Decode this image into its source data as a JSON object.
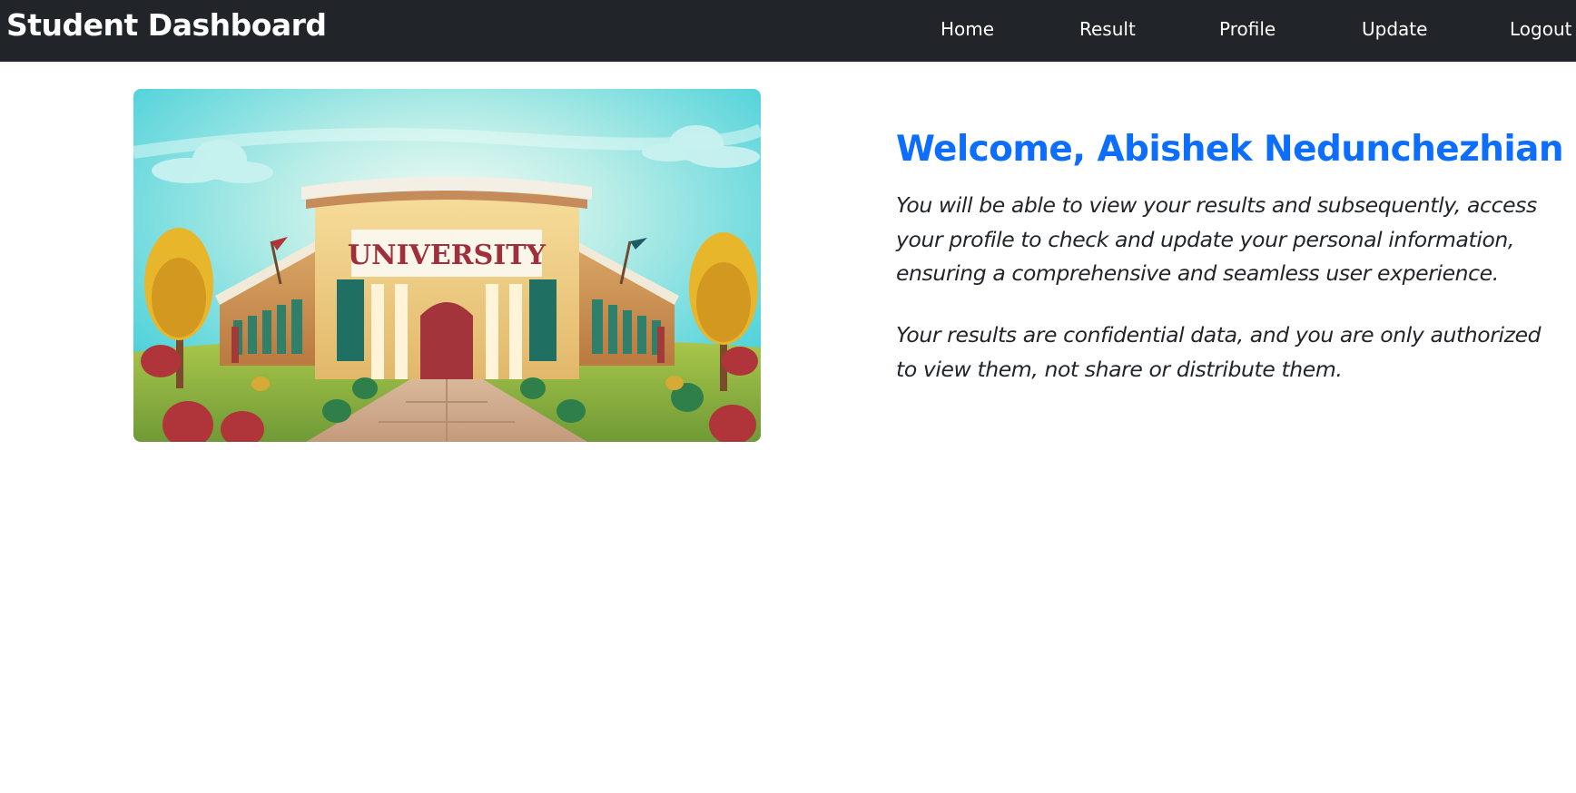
{
  "navbar": {
    "brand": "Student Dashboard",
    "links": [
      {
        "label": "Home"
      },
      {
        "label": "Result"
      },
      {
        "label": "Profile"
      },
      {
        "label": "Update"
      },
      {
        "label": "Logout"
      }
    ]
  },
  "hero": {
    "sign_text": "UNIVERSITY"
  },
  "main": {
    "welcome": "Welcome, Abishek Nedunchezhian",
    "paragraphs": [
      "You will be able to view your results and subsequently, access your profile to check and update your personal information, ensuring a comprehensive and seamless user experience.",
      "Your results are confidential data, and you are only authorized to view them, not share or distribute them."
    ]
  },
  "colors": {
    "navbar_bg": "#212529",
    "accent": "#0d6efd",
    "text": "#212529"
  }
}
